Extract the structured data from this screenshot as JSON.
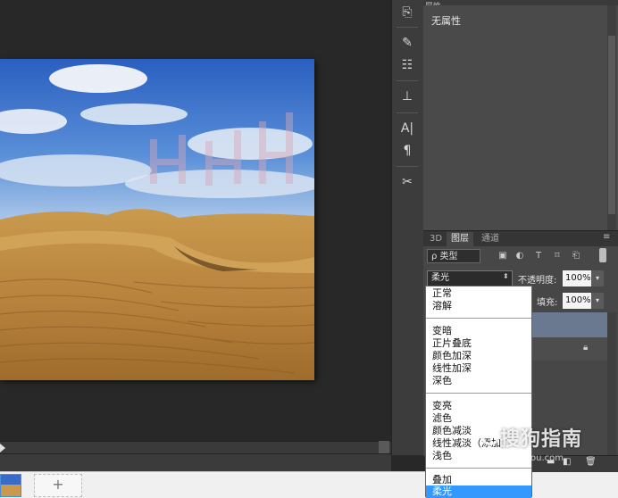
{
  "properties": {
    "tab_label": "屬性",
    "empty_text": "无属性"
  },
  "layers_panel": {
    "tabs": [
      {
        "label": "3D",
        "active": false
      },
      {
        "label": "图层",
        "active": true
      },
      {
        "label": "通道",
        "active": false
      }
    ],
    "menu_icon": "≡",
    "filter": {
      "select_label": "ρ 类型",
      "icons": [
        "image-filter-icon",
        "adjustment-filter-icon",
        "type-filter-icon",
        "shape-filter-icon",
        "smart-object-filter-icon"
      ]
    },
    "blend_mode": "柔光",
    "opacity_label": "不透明度:",
    "opacity_value": "100%",
    "fill_label": "填充:",
    "fill_value": "100%"
  },
  "blend_dropdown": {
    "groups": [
      [
        "正常",
        "溶解"
      ],
      [
        "变暗",
        "正片叠底",
        "颜色加深",
        "线性加深",
        "深色"
      ],
      [
        "变亮",
        "滤色",
        "颜色减淡",
        "线性减淡（添加）",
        "浅色"
      ],
      [
        "叠加",
        "柔光"
      ]
    ],
    "selected": "柔光"
  },
  "tools": [
    "history-icon",
    "brush-icon",
    "brush-presets-icon",
    "clone-source-icon",
    "character-icon",
    "paragraph-icon",
    "tool-presets-icon"
  ],
  "canvas": {
    "image_subject": "desert-dunes-blue-sky",
    "overlay_text": "HHH"
  },
  "thumbnails": {
    "add_label": "+"
  },
  "watermark": {
    "text": "搜狗指南",
    "url": "zhinan.sogou.com"
  },
  "colors": {
    "panel_bg": "#474747",
    "selected_item": "#3399ff",
    "canvas_bg": "#282828"
  }
}
